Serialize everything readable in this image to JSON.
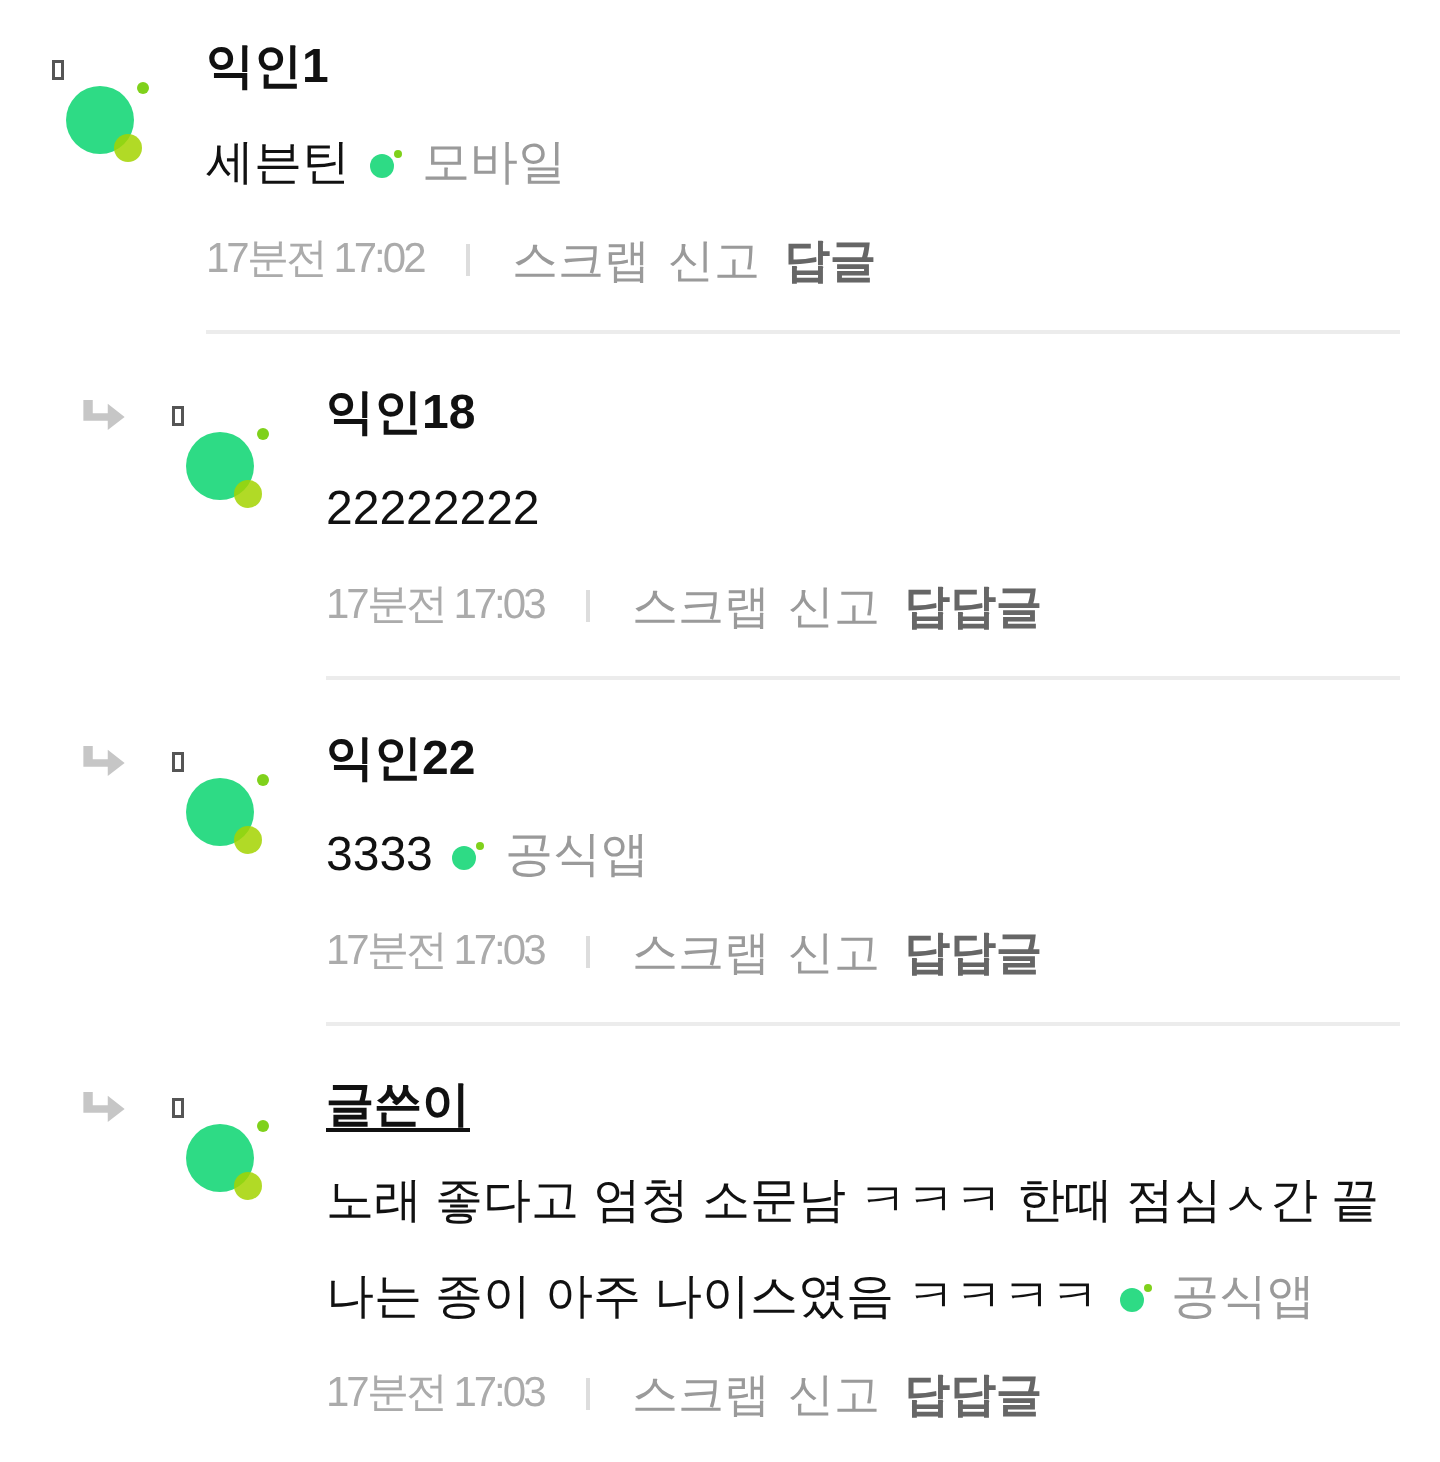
{
  "comments": [
    {
      "name": "익인1",
      "author": false,
      "lines": [
        "세븐틴"
      ],
      "device": "모바일",
      "time": "17분전 17:02",
      "actions": [
        "스크랩",
        "신고"
      ],
      "reply": "답글",
      "children": [
        {
          "name": "익인18",
          "author": false,
          "lines": [
            "22222222"
          ],
          "time": "17분전 17:03",
          "actions": [
            "스크랩",
            "신고"
          ],
          "reply": "답답글"
        },
        {
          "name": "익인22",
          "author": false,
          "lines": [
            "3333"
          ],
          "device": "공식앱",
          "time": "17분전 17:03",
          "actions": [
            "스크랩",
            "신고"
          ],
          "reply": "답답글"
        },
        {
          "name": "글쓴이",
          "author": true,
          "lines": [
            "노래 좋다고 엄청 소문남 ㅋㅋㅋ 한때 점심ㅅ간 끝",
            "나는 종이 아주 나이스였음 ㅋㅋㅋㅋ"
          ],
          "device": "공식앱",
          "time": "17분전 17:03",
          "actions": [
            "스크랩",
            "신고"
          ],
          "reply": "답답글"
        }
      ]
    }
  ]
}
